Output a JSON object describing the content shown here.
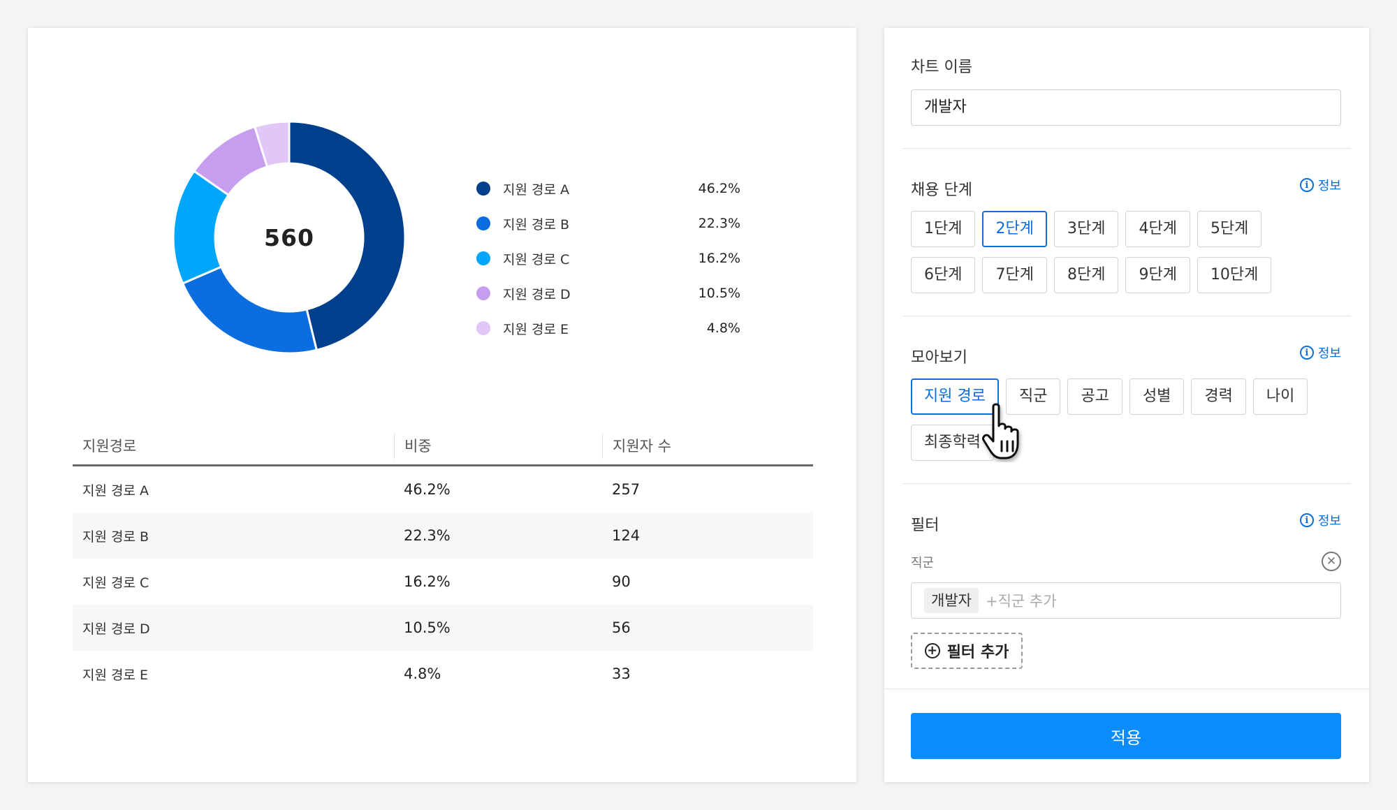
{
  "chart_data": {
    "type": "pie",
    "total_label": "560",
    "colors": [
      "#003f8c",
      "#0a6ee0",
      "#00a6fb",
      "#c79df0",
      "#e1c6f8"
    ],
    "series": [
      {
        "name": "지원 경로 A",
        "value": 46.2,
        "percent_label": "46.2%",
        "count": "257"
      },
      {
        "name": "지원 경로 B",
        "value": 22.3,
        "percent_label": "22.3%",
        "count": "124"
      },
      {
        "name": "지원 경로 C",
        "value": 16.2,
        "percent_label": "16.2%",
        "count": "90"
      },
      {
        "name": "지원 경로 D",
        "value": 10.5,
        "percent_label": "10.5%",
        "count": "56"
      },
      {
        "name": "지원 경로 E",
        "value": 4.8,
        "percent_label": "4.8%",
        "count": "33"
      }
    ]
  },
  "table": {
    "headers": [
      "지원경로",
      "비중",
      "지원자 수"
    ]
  },
  "settings": {
    "chart_name": {
      "title": "차트 이름",
      "value": "개발자"
    },
    "stage": {
      "title": "채용 단계",
      "info": "정보",
      "options": [
        "1단계",
        "2단계",
        "3단계",
        "4단계",
        "5단계",
        "6단계",
        "7단계",
        "8단계",
        "9단계",
        "10단계"
      ],
      "selected": "2단계"
    },
    "group": {
      "title": "모아보기",
      "info": "정보",
      "options": [
        "지원 경로",
        "직군",
        "공고",
        "성별",
        "경력",
        "나이",
        "최종학력"
      ],
      "selected": "지원 경로"
    },
    "filter": {
      "title": "필터",
      "info": "정보",
      "field_label": "직군",
      "tag": "개발자",
      "placeholder": "+직군 추가",
      "add_label": "필터 추가"
    },
    "apply_label": "적용",
    "accent": "#0a6ee0",
    "apply_color": "#0a8cff"
  }
}
